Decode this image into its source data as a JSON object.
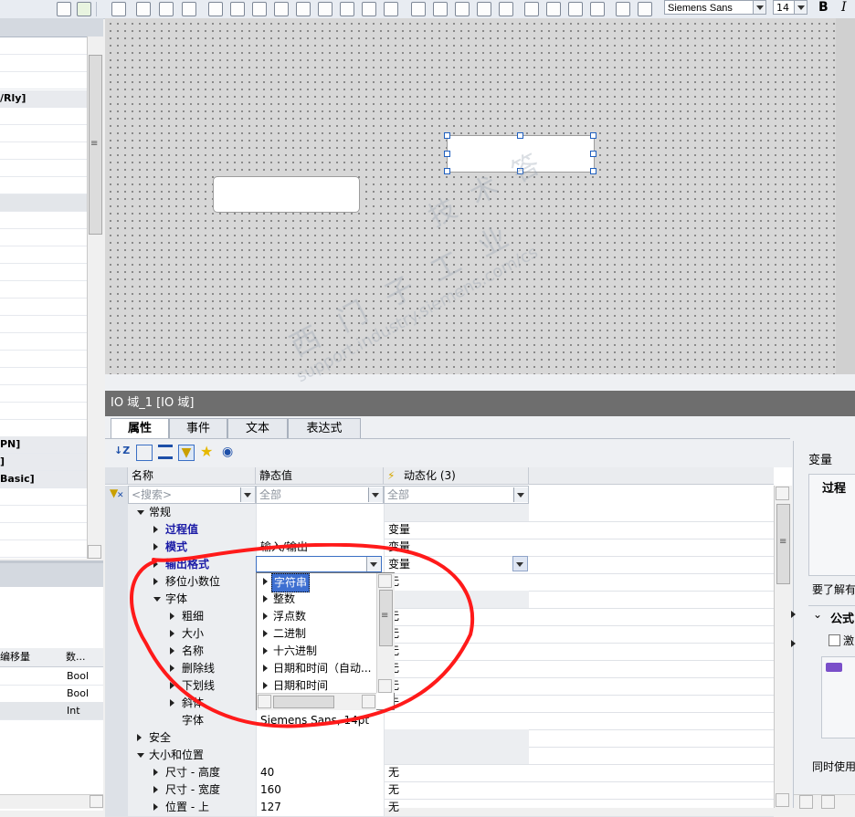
{
  "toolbar": {
    "font_name": "Siemens Sans",
    "font_size": "14",
    "bold_label": "B",
    "italic_label": "I"
  },
  "left_panel": {
    "rows": [
      "",
      "",
      "",
      "/Rly]",
      "",
      "",
      "",
      "",
      "",
      "",
      "",
      "",
      "",
      "",
      "",
      "",
      "",
      "",
      "",
      "",
      "",
      "",
      "",
      "PN]",
      "]",
      "Basic]",
      "",
      "",
      "",
      "",
      ""
    ],
    "bottom_header_partial": "编移量",
    "bottom_header_partial2": "数...",
    "bottom_rows": [
      {
        "type": "Bool"
      },
      {
        "type": "Bool"
      },
      {
        "type": "Int"
      }
    ]
  },
  "inspector": {
    "title": "IO 域_1 [IO 域]",
    "tabs": [
      "属性",
      "事件",
      "文本",
      "表达式"
    ],
    "columns": {
      "name": "名称",
      "static": "静态值",
      "dynamic": "动态化 (3)"
    },
    "filters": {
      "name": "<搜索>",
      "static": "全部",
      "dynamic": "全部"
    },
    "rows": [
      {
        "name": "常规",
        "static": "",
        "dynamic": "",
        "level": 0,
        "expander": "down",
        "style": "normal"
      },
      {
        "name": "过程值",
        "static": "",
        "dynamic": "变量",
        "level": 1,
        "expander": "right",
        "style": "bold-blue"
      },
      {
        "name": "模式",
        "static": "输入/输出",
        "dynamic": "变量",
        "level": 1,
        "expander": "right",
        "style": "bold-blue"
      },
      {
        "name": "输出格式",
        "static": "",
        "dynamic": "变量",
        "level": 1,
        "expander": "right",
        "style": "bold-blue"
      },
      {
        "name": "移位小数位",
        "static": "",
        "dynamic": "无",
        "level": 1,
        "expander": "right",
        "style": "normal"
      },
      {
        "name": "字体",
        "static": "",
        "dynamic": "",
        "level": 1,
        "expander": "down",
        "style": "normal"
      },
      {
        "name": "粗细",
        "static": "",
        "dynamic": "无",
        "level": 2,
        "expander": "right",
        "style": "normal"
      },
      {
        "name": "大小",
        "static": "",
        "dynamic": "无",
        "level": 2,
        "expander": "right",
        "style": "normal"
      },
      {
        "name": "名称",
        "static": "",
        "dynamic": "无",
        "level": 2,
        "expander": "right",
        "style": "normal"
      },
      {
        "name": "删除线",
        "static": "",
        "dynamic": "无",
        "level": 2,
        "expander": "right",
        "style": "normal"
      },
      {
        "name": "下划线",
        "static": "",
        "dynamic": "无",
        "level": 2,
        "expander": "right",
        "style": "normal"
      },
      {
        "name": "斜体",
        "static": "",
        "dynamic": "无",
        "level": 2,
        "expander": "right",
        "style": "normal"
      },
      {
        "name": "字体",
        "static": "Siemens Sans, 14pt",
        "dynamic": "",
        "level": 2,
        "expander": "none",
        "style": "normal"
      },
      {
        "name": "安全",
        "static": "",
        "dynamic": "",
        "level": 0,
        "expander": "right",
        "style": "normal"
      },
      {
        "name": "大小和位置",
        "static": "",
        "dynamic": "",
        "level": 0,
        "expander": "down",
        "style": "normal"
      },
      {
        "name": "尺寸 - 高度",
        "static": "40",
        "dynamic": "无",
        "level": 1,
        "expander": "right",
        "style": "normal"
      },
      {
        "name": "尺寸 - 宽度",
        "static": "160",
        "dynamic": "无",
        "level": 1,
        "expander": "right",
        "style": "normal"
      },
      {
        "name": "位置 - 上",
        "static": "127",
        "dynamic": "无",
        "level": 1,
        "expander": "right",
        "style": "normal"
      }
    ],
    "format_dropdown": {
      "options": [
        "字符串",
        "整数",
        "浮点数",
        "二进制",
        "十六进制",
        "日期和时间（自动...",
        "日期和时间"
      ],
      "selected_index": 0
    }
  },
  "right_panel": {
    "var_label": "变量",
    "process_label": "过程",
    "hint_partial": "要了解有",
    "formula_partial": "公式",
    "checkbox_partial": "激",
    "bottom_partial": "同时使用"
  },
  "watermark": {
    "line1": "技 术 答",
    "line2": "西 门 子 工 业",
    "line3": "support.industry.siemens.com/cs"
  },
  "colors": {
    "accent_blue": "#1f5fbf",
    "selection": "#3d6fd1",
    "annotation_red": "#ff1a1a"
  }
}
